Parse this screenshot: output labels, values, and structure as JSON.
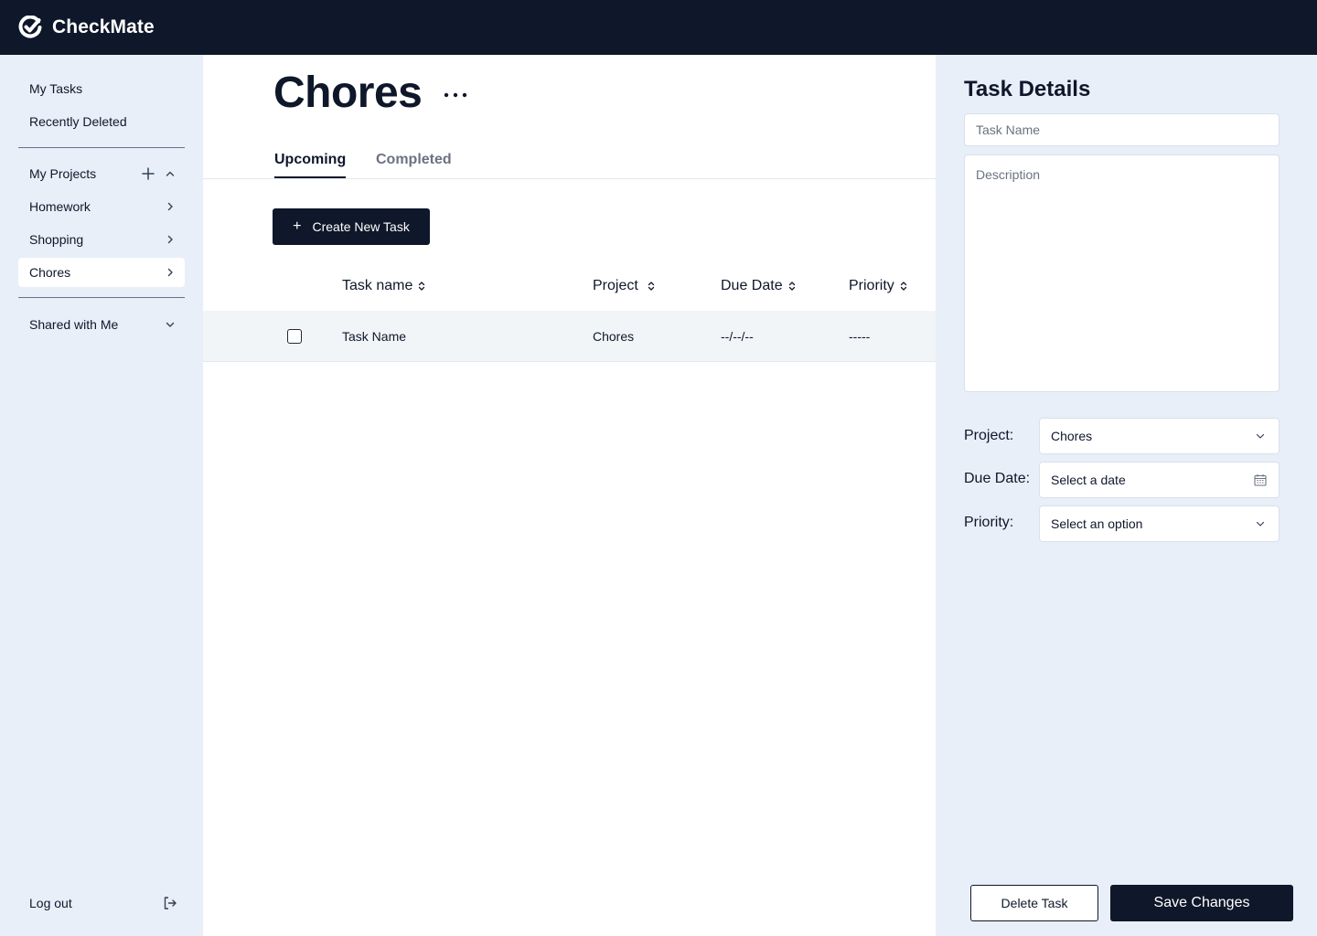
{
  "app": {
    "title": "CheckMate",
    "logo_icon": "check-circle-logo-icon"
  },
  "sidebar": {
    "my_tasks": "My Tasks",
    "recently_deleted": "Recently Deleted",
    "my_projects": "My Projects",
    "projects": [
      {
        "label": "Homework"
      },
      {
        "label": "Shopping"
      },
      {
        "label": "Chores"
      }
    ],
    "active_project": "Chores",
    "shared_with_me": "Shared with Me",
    "logout": "Log out"
  },
  "main": {
    "title": "Chores",
    "tabs": [
      {
        "label": "Upcoming",
        "active": true
      },
      {
        "label": "Completed",
        "active": false
      }
    ],
    "create_button": {
      "icon": "+",
      "label": "Create New Task"
    },
    "columns": [
      "Task name",
      "Project",
      "Due Date",
      "Priority"
    ],
    "rows": [
      {
        "task_name": "Task Name",
        "project": "Chores",
        "due_date": "--/--/--",
        "priority": "-----",
        "checked": false
      }
    ]
  },
  "details": {
    "title": "Task Details",
    "task_name_placeholder": "Task Name",
    "description_placeholder": "Description",
    "project_label": "Project:",
    "project_value": "Chores",
    "due_date_label": "Due Date:",
    "due_date_value": "Select a date",
    "priority_label": "Priority:",
    "priority_value": "Select an option",
    "delete_button": "Delete Task",
    "save_button": "Save Changes"
  },
  "colors": {
    "navy": "#0f172a",
    "sidebar_bg": "#e8eff9",
    "row_bg": "#f2f5f8",
    "muted": "#6b7280"
  }
}
